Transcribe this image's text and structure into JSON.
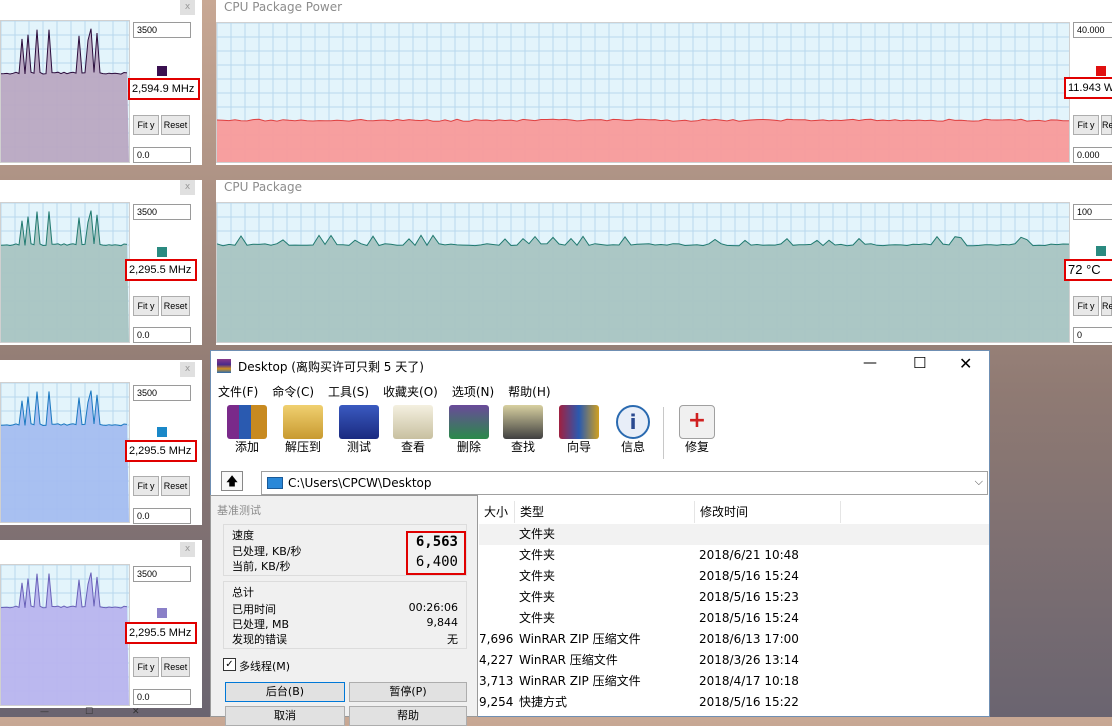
{
  "monitors": {
    "p1": {
      "max": "3500",
      "value": "2,594.9 MHz",
      "min": "0.0",
      "color": "#3a1050",
      "fill": "#b9a8c2",
      "line": "#2b0c3c"
    },
    "p2": {
      "max": "3500",
      "value": "2,295.5 MHz",
      "min": "0.0",
      "color": "#2a8a80",
      "fill": "#a8c4c2",
      "line": "#207a70"
    },
    "p3": {
      "max": "3500",
      "value": "2,295.5 MHz",
      "min": "0.0",
      "color": "#1a88c8",
      "fill": "#a4bdf0",
      "line": "#1a78c0"
    },
    "p4": {
      "max": "3500",
      "value": "2,295.5 MHz",
      "min": "0.0",
      "color": "#8a80c8",
      "fill": "#b8b4ee",
      "line": "#6860b8"
    },
    "power": {
      "title": "CPU Package Power",
      "max": "40.000",
      "value": "11.943 W",
      "min": "0.000",
      "color": "#e01010",
      "fill": "#f89a9a",
      "line": "#e04040"
    },
    "temp": {
      "title": "CPU Package",
      "max": "100",
      "value": "72 °C",
      "min": "0",
      "color": "#2a8a80",
      "fill": "#a8c4c2",
      "line": "#207a70"
    }
  },
  "buttons": {
    "fit": "Fit y",
    "reset": "Reset",
    "reset_short": "Re",
    "close_x": "x"
  },
  "winrar": {
    "title": "Desktop (离购买许可只剩 5 天了)",
    "menu": [
      "文件(F)",
      "命令(C)",
      "工具(S)",
      "收藏夹(O)",
      "选项(N)",
      "帮助(H)"
    ],
    "tools": [
      "添加",
      "解压到",
      "测试",
      "查看",
      "删除",
      "查找",
      "向导",
      "信息",
      "修复"
    ],
    "path": "C:\\Users\\CPCW\\Desktop",
    "columns": {
      "size": "大小",
      "type": "类型",
      "modified": "修改时间"
    },
    "rows": [
      {
        "size": "",
        "type": "文件夹",
        "date": ""
      },
      {
        "size": "",
        "type": "文件夹",
        "date": "2018/6/21 10:48"
      },
      {
        "size": "",
        "type": "文件夹",
        "date": "2018/5/16 15:24"
      },
      {
        "size": "",
        "type": "文件夹",
        "date": "2018/5/16 15:23"
      },
      {
        "size": "",
        "type": "文件夹",
        "date": "2018/5/16 15:24"
      },
      {
        "size": "7,696",
        "type": "WinRAR ZIP 压缩文件",
        "date": "2018/6/13 17:00"
      },
      {
        "size": "4,227",
        "type": "WinRAR 压缩文件",
        "date": "2018/3/26 13:14"
      },
      {
        "size": "3,713",
        "type": "WinRAR ZIP 压缩文件",
        "date": "2018/4/17 10:18"
      },
      {
        "size": "9,254",
        "type": "快捷方式",
        "date": "2018/5/16 15:22"
      }
    ]
  },
  "bench": {
    "title": "基准测试",
    "speed_group": "速度",
    "processed_label": "已处理, KB/秒",
    "current_label": "当前, KB/秒",
    "processed_value": "6,563",
    "current_value": "6,400",
    "total_group": "总计",
    "elapsed_label": "已用时间",
    "elapsed_value": "00:26:06",
    "mb_label": "已处理, MB",
    "mb_value": "9,844",
    "errors_label": "发现的错误",
    "errors_value": "无",
    "multithread": "多线程(M)",
    "background": "后台(B)",
    "pause": "暂停(P)",
    "cancel": "取消",
    "help": "帮助"
  }
}
